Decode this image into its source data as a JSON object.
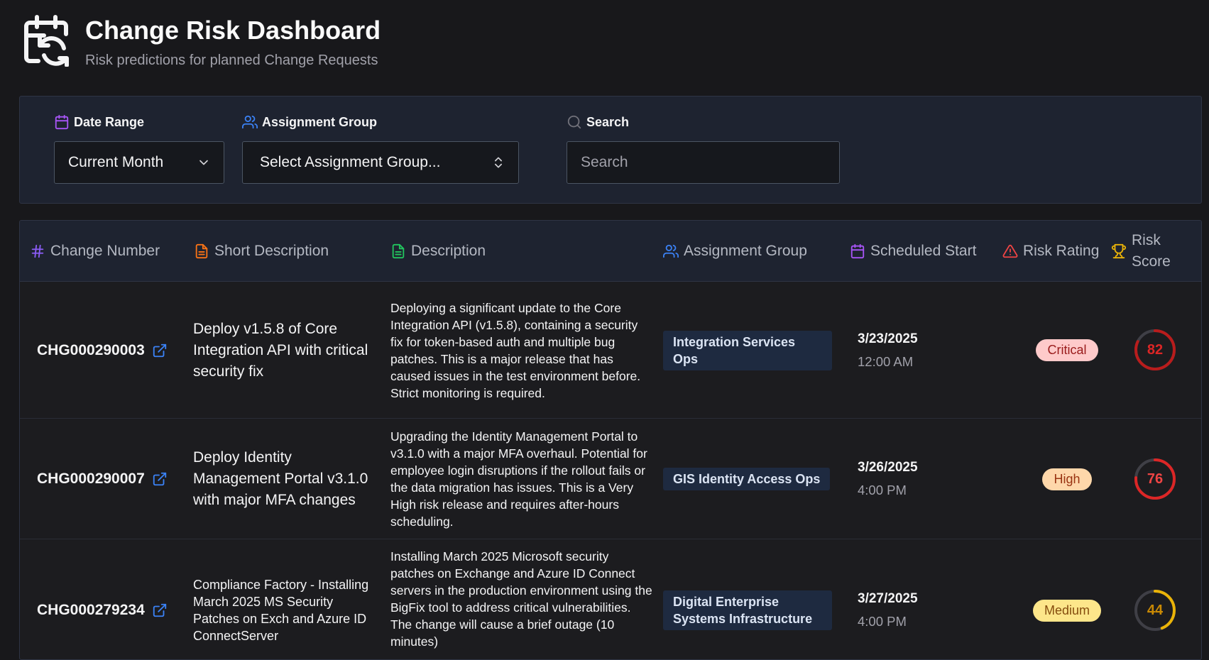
{
  "header": {
    "title": "Change Risk Dashboard",
    "subtitle": "Risk predictions for planned Change Requests",
    "logo_icon": "calendar-refresh-icon"
  },
  "filters": {
    "date_range": {
      "label": "Date Range",
      "value": "Current Month",
      "icon": "calendar-icon"
    },
    "assignment_group": {
      "label": "Assignment Group",
      "value": "Select Assignment Group...",
      "icon": "users-icon"
    },
    "search": {
      "label": "Search",
      "placeholder": "Search",
      "value": "",
      "icon": "search-icon"
    }
  },
  "table": {
    "columns": [
      {
        "label": "Change Number",
        "icon": "hash-icon"
      },
      {
        "label": "Short Description",
        "icon": "file-text-icon"
      },
      {
        "label": "Description",
        "icon": "file-text-icon"
      },
      {
        "label": "Assignment Group",
        "icon": "users-icon"
      },
      {
        "label": "Scheduled Start",
        "icon": "calendar-icon"
      },
      {
        "label": "Risk Rating",
        "icon": "alert-triangle-icon"
      },
      {
        "label": "Risk Score",
        "icon": "trophy-icon"
      }
    ],
    "rows": [
      {
        "number": "CHG000290003",
        "short": "Deploy v1.5.8 of Core Integration API with critical security fix",
        "description": "Deploying a significant update to the Core Integration API (v1.5.8), containing a security fix for token-based auth and multiple bug patches. This is a major release that has caused issues in the test environment before. Strict monitoring is required.",
        "group": "Integration Services Ops",
        "date": "3/23/2025",
        "time": "12:00 AM",
        "rating": "Critical",
        "score": 82,
        "colors": {
          "pill_bg": "#fecaca",
          "pill_fg": "#991b1b",
          "ring": "#b91c1c",
          "num": "#dc2626"
        }
      },
      {
        "number": "CHG000290007",
        "short": "Deploy Identity Management Portal v3.1.0 with major MFA changes",
        "description": "Upgrading the Identity Management Portal to v3.1.0 with a major MFA overhaul. Potential for employee login disruptions if the rollout fails or the data migration has issues. This is a Very High risk release and requires after-hours scheduling.",
        "group": "GIS Identity Access Ops",
        "date": "3/26/2025",
        "time": "4:00 PM",
        "rating": "High",
        "score": 76,
        "colors": {
          "pill_bg": "#fed7aa",
          "pill_fg": "#9a3412",
          "ring": "#dc2626",
          "num": "#ef4444"
        }
      },
      {
        "number": "CHG000279234",
        "short": "Compliance Factory - Installing March 2025 MS Security Patches on Exch and Azure ID ConnectServer",
        "description": "Installing March 2025 Microsoft security patches on Exchange and Azure ID Connect servers in the production environment using the BigFix tool to address critical vulnerabilities. The change will cause a brief outage (10 minutes)",
        "group": "Digital Enterprise Systems Infrastructure",
        "date": "3/27/2025",
        "time": "4:00 PM",
        "rating": "Medium",
        "score": 44,
        "colors": {
          "pill_bg": "#fde68a",
          "pill_fg": "#854d0e",
          "ring": "#eab308",
          "num": "#ca8a04"
        }
      }
    ]
  },
  "colors": {
    "background": "#18181b",
    "panel": "#1e2330",
    "accent_purple": "#a855f7",
    "accent_blue": "#3b82f6",
    "accent_orange": "#f97316",
    "accent_green": "#22c55e",
    "accent_red": "#ef4444",
    "accent_yellow": "#eab308"
  }
}
